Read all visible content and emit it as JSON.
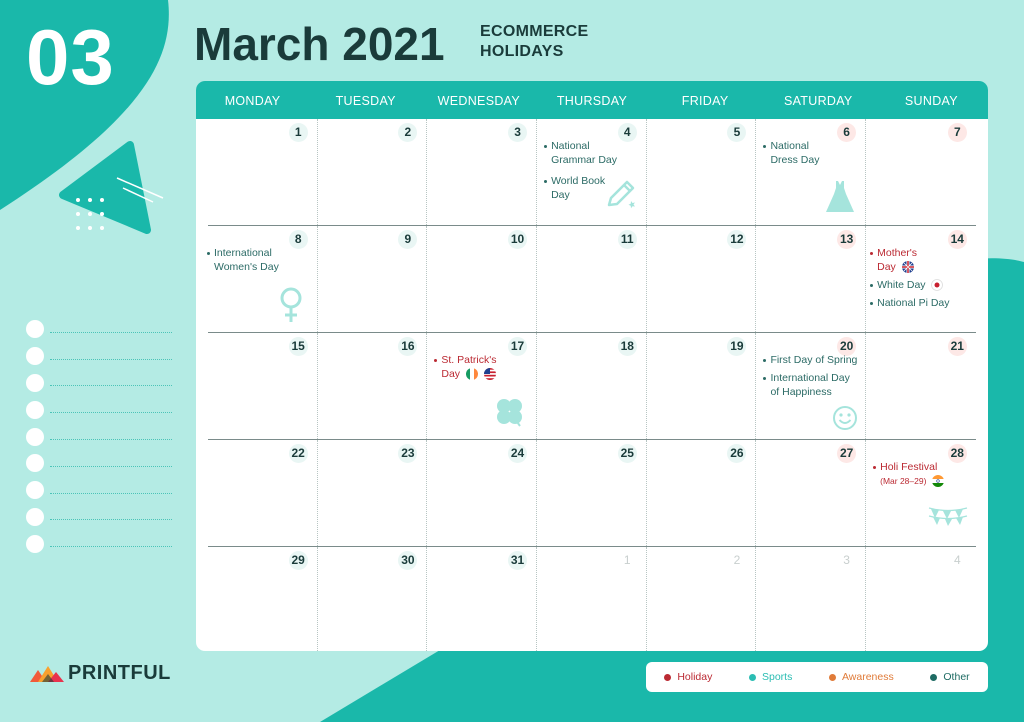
{
  "month_number": "03",
  "title": "March 2021",
  "subtitle_line1": "ECOMMERCE",
  "subtitle_line2": "HOLIDAYS",
  "weekdays": [
    "MONDAY",
    "TUESDAY",
    "WEDNESDAY",
    "THURSDAY",
    "FRIDAY",
    "SATURDAY",
    "SUNDAY"
  ],
  "weeks": [
    [
      "1",
      "2",
      "3",
      "4",
      "5",
      "6",
      "7"
    ],
    [
      "8",
      "9",
      "10",
      "11",
      "12",
      "13",
      "14"
    ],
    [
      "15",
      "16",
      "17",
      "18",
      "19",
      "20",
      "21"
    ],
    [
      "22",
      "23",
      "24",
      "25",
      "26",
      "27",
      "28"
    ],
    [
      "29",
      "30",
      "31",
      "1",
      "2",
      "3",
      "4"
    ]
  ],
  "events": {
    "national_grammar_day": {
      "line1": "National",
      "line2": "Grammar Day"
    },
    "world_book_day": {
      "line1": "World Book",
      "line2": "Day"
    },
    "national_dress_day": {
      "line1": "National",
      "line2": "Dress Day"
    },
    "international_womens_day": {
      "line1": "International",
      "line2": "Women's Day"
    },
    "mothers_day": {
      "line1": "Mother's",
      "line2": "Day"
    },
    "white_day": "White Day",
    "national_pi_day": "National Pi Day",
    "st_patricks_day": {
      "line1": "St. Patrick's",
      "line2": "Day"
    },
    "first_day_of_spring": "First Day of Spring",
    "international_day_of_happiness": {
      "line1": "International Day",
      "line2": "of Happiness"
    },
    "holi_festival": {
      "line1": "Holi Festival",
      "line2": "(Mar 28–29)"
    }
  },
  "brand": "PRINTFUL",
  "legend": [
    {
      "label": "Holiday",
      "color": "#bb2a33"
    },
    {
      "label": "Sports",
      "color": "#2bbdb3"
    },
    {
      "label": "Awareness",
      "color": "#e07b39"
    },
    {
      "label": "Other",
      "color": "#1e6b63"
    }
  ],
  "colors": {
    "background": "#b4ebe4",
    "accent": "#1ab8aa",
    "dark_text": "#1a3b3a",
    "holiday_red": "#bb2a33"
  }
}
